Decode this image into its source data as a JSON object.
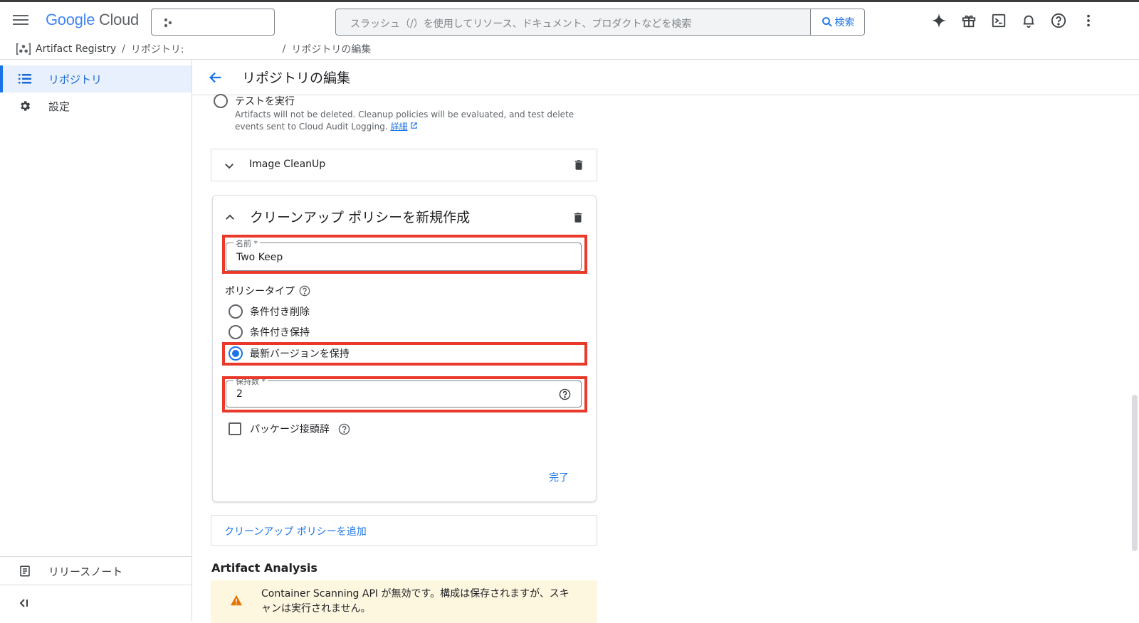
{
  "header": {
    "logo_google": "Google",
    "logo_cloud": "Cloud",
    "search_placeholder": "スラッシュ（/）を使用してリソース、ドキュメント、プロダクトなどを検索",
    "search_button": "検索"
  },
  "breadcrumb": {
    "service": "Artifact Registry",
    "repo": "リポジトリ:",
    "current": "リポジトリの編集",
    "separator": "/"
  },
  "sidebar": {
    "items": [
      {
        "label": "リポジトリ",
        "icon": "list-icon",
        "active": true
      },
      {
        "label": "設定",
        "icon": "gear-icon",
        "active": false
      }
    ],
    "release_notes": "リリースノート"
  },
  "page": {
    "title": "リポジトリの編集"
  },
  "dry_run": {
    "label": "テストを実行",
    "description": "Artifacts will not be deleted. Cleanup policies will be evaluated, and test delete events sent to Cloud Audit Logging.",
    "link": "詳細"
  },
  "policies": [
    {
      "name": "Image CleanUp",
      "expanded": false
    }
  ],
  "new_policy": {
    "title": "クリーンアップ ポリシーを新規作成",
    "name_label": "名前 *",
    "name_value": "Two Keep",
    "policy_type_label": "ポリシータイプ",
    "options": [
      {
        "label": "条件付き削除",
        "checked": false
      },
      {
        "label": "条件付き保持",
        "checked": false
      },
      {
        "label": "最新バージョンを保持",
        "checked": true
      }
    ],
    "keep_count_label": "保持数 *",
    "keep_count_value": "2",
    "package_prefix_label": "パッケージ接頭辞",
    "done_button": "完了"
  },
  "add_policy": "クリーンアップ ポリシーを追加",
  "artifact_analysis": {
    "heading": "Artifact Analysis",
    "warning_line1": "Container Scanning API が無効です。構成は保存されますが、スキ",
    "warning_line2": "ャンは実行されません。"
  },
  "colors": {
    "accent": "#1a73e8",
    "highlight": "#e8392b",
    "warning_bg": "#fef7e0",
    "warning_icon": "#e37400"
  }
}
